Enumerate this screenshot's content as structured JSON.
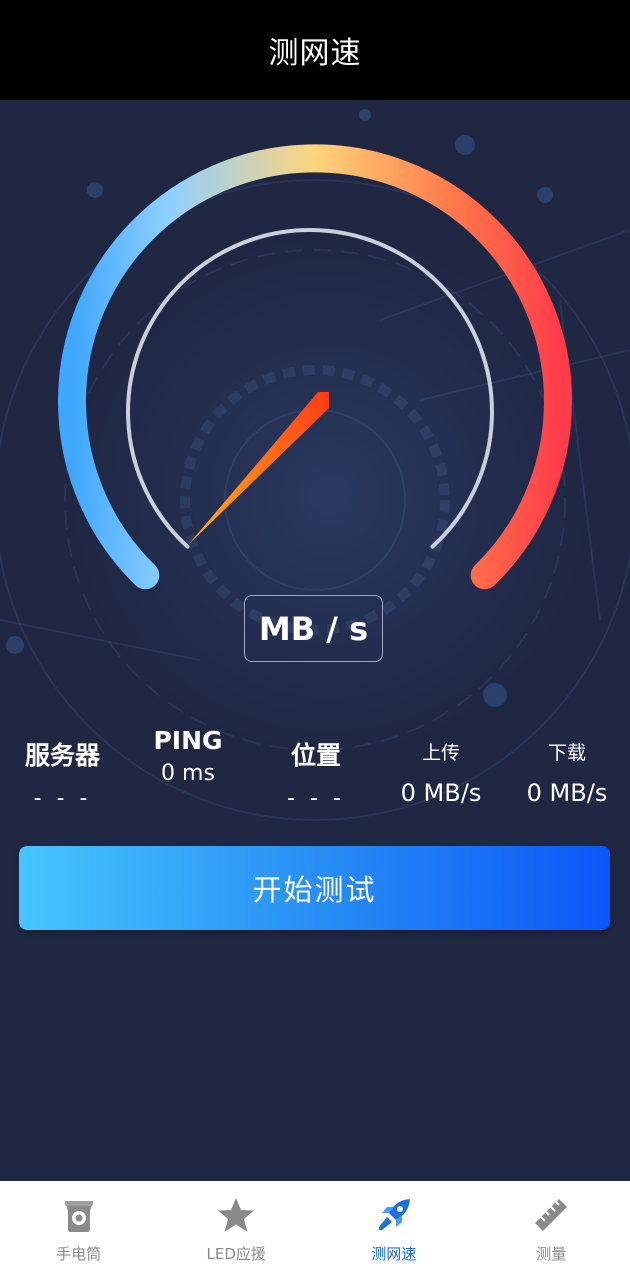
{
  "titlebar": {
    "title": "测网速"
  },
  "gauge": {
    "unit": "MB / s",
    "needle_fraction": 0.0,
    "colors": {
      "start": "#45b0ff",
      "mid": "#ffd37a",
      "end": "#ff4545"
    }
  },
  "stats": {
    "server": {
      "label": "服务器",
      "value": "- - -"
    },
    "ping": {
      "label": "PING",
      "value": "0 ms"
    },
    "location": {
      "label": "位置",
      "value": "- - -"
    },
    "upload": {
      "label": "上传",
      "value": "0 MB/s"
    },
    "download": {
      "label": "下载",
      "value": "0 MB/s"
    }
  },
  "start_button": {
    "label": "开始测试"
  },
  "tabbar": {
    "active": "测网速",
    "tabs": [
      {
        "label": "手电筒",
        "icon": "flashlight-icon"
      },
      {
        "label": "LED应援",
        "icon": "star-icon"
      },
      {
        "label": "测网速",
        "icon": "rocket-icon"
      },
      {
        "label": "测量",
        "icon": "ruler-icon"
      }
    ]
  }
}
